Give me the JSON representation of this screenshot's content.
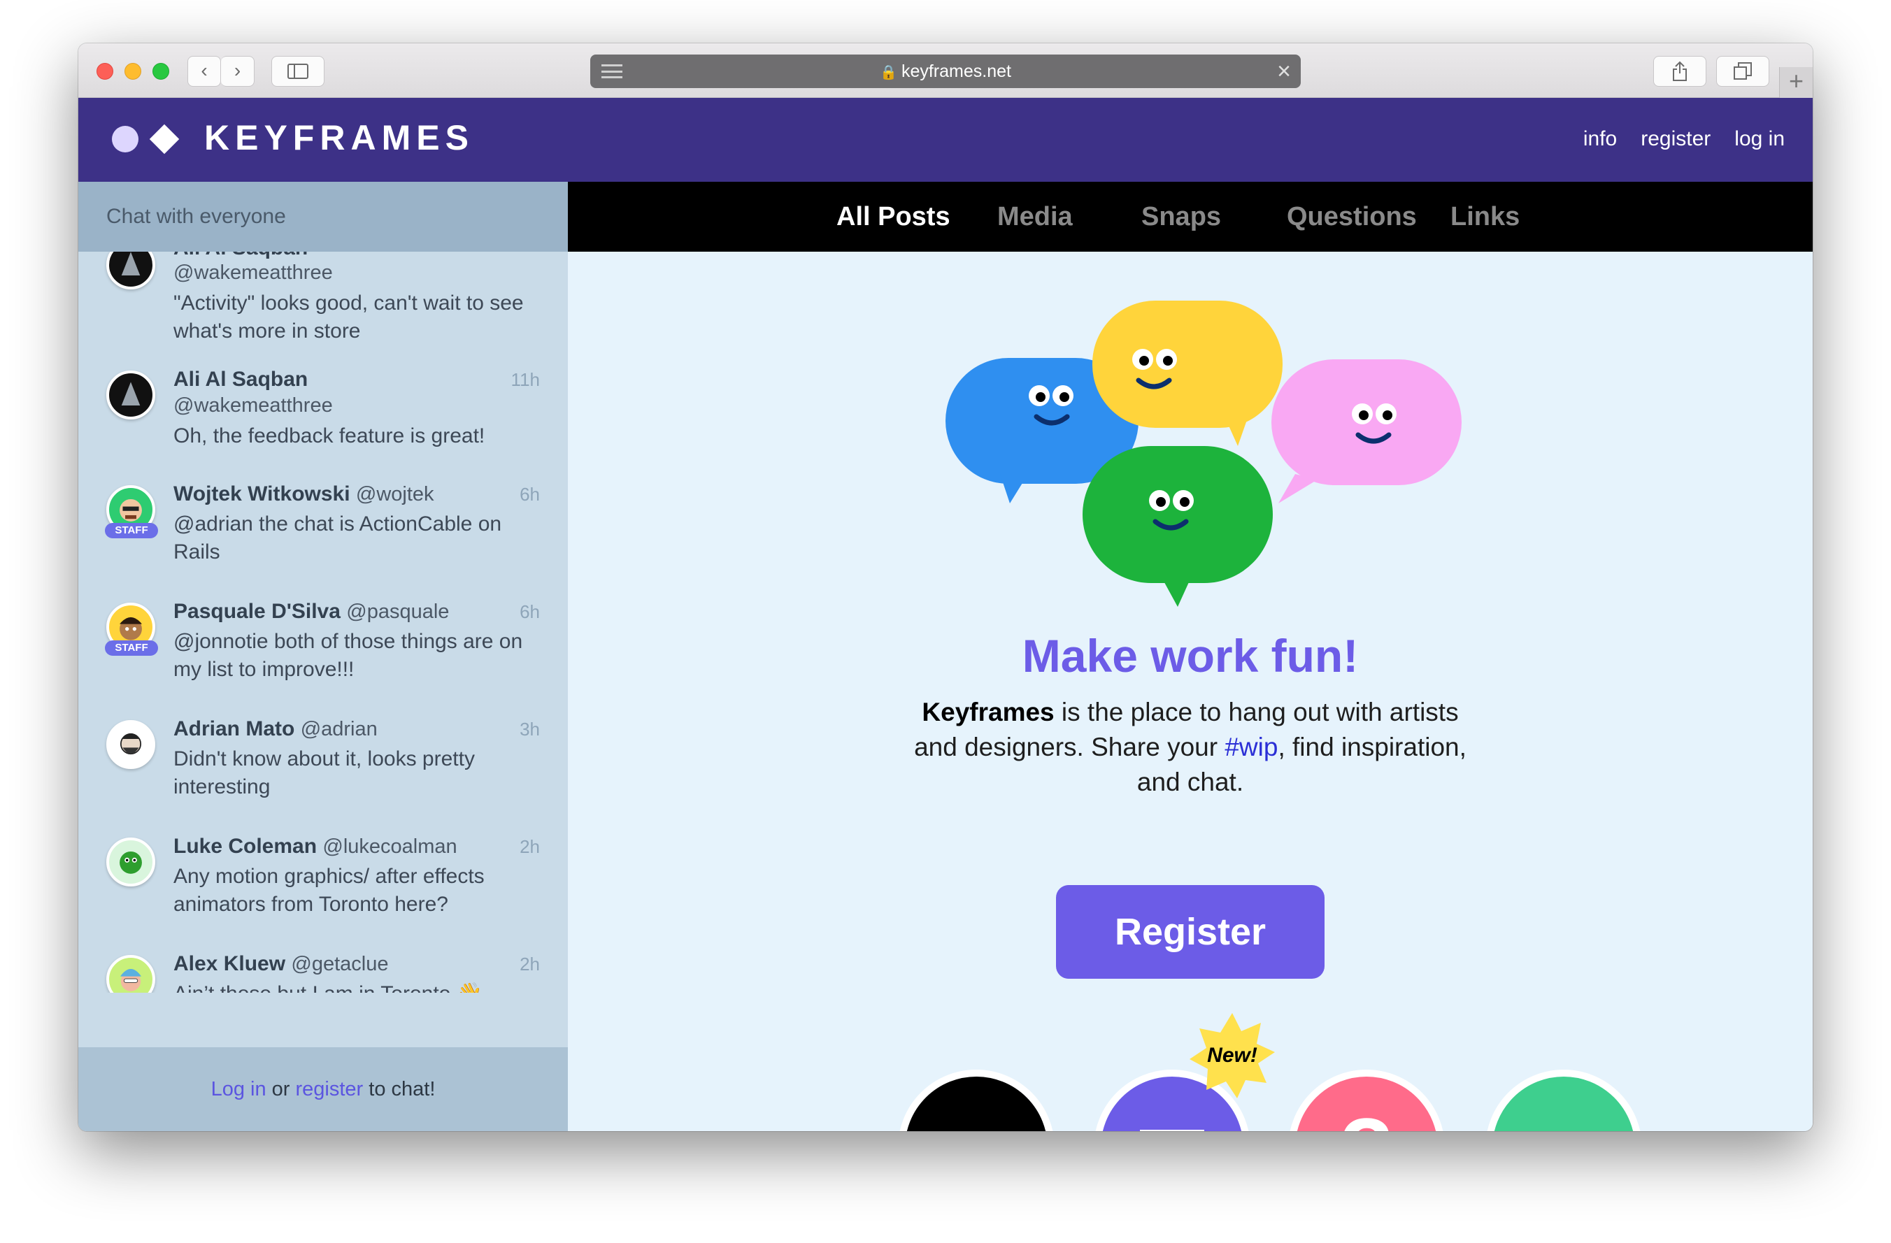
{
  "browser": {
    "url": "keyframes.net",
    "nav_back": "‹",
    "nav_forward": "›",
    "new_tab": "+"
  },
  "site": {
    "logo_text": "KEYFRAMES",
    "nav": [
      "info",
      "register",
      "log in"
    ]
  },
  "sidebar": {
    "title": "Chat with everyone",
    "messages": [
      {
        "name": "Ali Al Saqban",
        "handle": "@wakemeatthree",
        "time": "",
        "text": "\"Activity\" looks good, can't wait to see what's more in store",
        "staff": false
      },
      {
        "name": "Ali Al Saqban",
        "handle": "@wakemeatthree",
        "time": "11h",
        "text": "Oh, the feedback feature is great!",
        "staff": false
      },
      {
        "name": "Wojtek Witkowski",
        "handle": "@wojtek",
        "time": "6h",
        "text": "@adrian the chat is ActionCable on Rails",
        "staff": true
      },
      {
        "name": "Pasquale D'Silva",
        "handle": "@pasquale",
        "time": "6h",
        "text": "@jonnotie both of those things are on my list to improve!!!",
        "staff": true
      },
      {
        "name": "Adrian Mato",
        "handle": "@adrian",
        "time": "3h",
        "text": "Didn't know about it, looks pretty interesting",
        "staff": false
      },
      {
        "name": "Luke Coleman",
        "handle": "@lukecoalman",
        "time": "2h",
        "text": "Any motion graphics/ after effects animators from Toronto here?",
        "staff": false
      },
      {
        "name": "Alex Kluew",
        "handle": "@getaclue",
        "time": "2h",
        "text": "Ain’t those but I am in Toronto 👋",
        "staff": false
      }
    ],
    "staff_label": "STAFF",
    "footer": {
      "login": "Log in",
      "or": " or ",
      "register": "register",
      "suffix": " to chat!"
    }
  },
  "tabs": [
    "All Posts",
    "Media",
    "Snaps",
    "Questions",
    "Links"
  ],
  "hero": {
    "headline": "Make work fun!",
    "brand": "Keyframes",
    "text_1": " is the place to hang out with artists and designers. Share your ",
    "hashtag": "#wip",
    "text_2": ", find inspiration, and chat.",
    "register_button": "Register",
    "new_badge": "New!"
  },
  "colors": {
    "header": "#3d3187",
    "accent": "#6c5ce7",
    "bubble_blue": "#2f8ff0",
    "bubble_yellow": "#ffd43b",
    "bubble_pink": "#f9a8f3",
    "bubble_green": "#1db33c"
  }
}
